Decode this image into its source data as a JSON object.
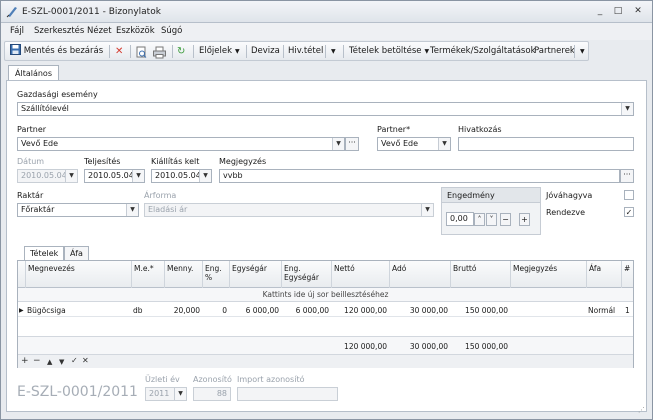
{
  "window": {
    "title": "E-SZL-0001/2011 - Bizonylatok",
    "controls": [
      "_",
      "□",
      "✕"
    ]
  },
  "menu": [
    "Fájl",
    "Szerkesztés",
    "Nézet",
    "Eszközök",
    "Súgó"
  ],
  "toolbar": {
    "save_close": "Mentés és bezárás",
    "elojelek": "Előjelek",
    "deviza": "Deviza",
    "hiv_tetel": "Hiv.tétel",
    "tetelek_betoltese": "Tételek betöltése",
    "termekek": "Termékek/Szolgáltatások",
    "partnerek": "Partnerek"
  },
  "tab": "Általános",
  "form": {
    "gazdasagi_esemeny_label": "Gazdasági esemény",
    "gazdasagi_esemeny_value": "Szállítólevél",
    "partner_label": "Partner",
    "partner_value": "Vevő Ede",
    "partner2_label": "Partner*",
    "partner2_value": "Vevő Ede",
    "hivatkozas_label": "Hivatkozás",
    "hivatkozas_value": "",
    "datum_label": "Dátum",
    "datum_value": "2010.05.04.",
    "teljesites_label": "Teljesítés",
    "teljesites_value": "2010.05.04.",
    "kiallitas_label": "Kiállítás kelt",
    "kiallitas_value": "2010.05.04.",
    "megjegyzes_label": "Megjegyzés",
    "megjegyzes_value": "vvbb",
    "raktar_label": "Raktár",
    "raktar_value": "Főraktár",
    "arforma_label": "Árforma",
    "arforma_value": "Eladási ár",
    "engedmeny_label": "Engedmény",
    "engedmeny_value": "0,00",
    "jovahagyva_label": "Jóváhagyva",
    "rendezve_label": "Rendezve",
    "jovahagyva_checked": false,
    "rendezve_checked": true
  },
  "grid_tabs": [
    "Tételek",
    "Áfa"
  ],
  "grid": {
    "columns": [
      "Megnevezés",
      "M.e.*",
      "Menny.",
      "Eng. %",
      "Egységár",
      "Eng. Egységár",
      "Nettó",
      "Adó",
      "Bruttó",
      "Megjegyzés",
      "Áfa",
      "#"
    ],
    "new_row_hint": "Kattints ide új sor beillesztéséhez",
    "rows": [
      [
        "Bügöcsiga",
        "db",
        "20,000",
        "0",
        "6 000,00",
        "6 000,00",
        "120 000,00",
        "30 000,00",
        "150 000,00",
        "",
        "Normál",
        "1"
      ]
    ],
    "totals": {
      "netto": "120 000,00",
      "ado": "30 000,00",
      "brutto": "150 000,00"
    }
  },
  "footer": {
    "doc_number": "E-SZL-0001/2011",
    "uzleti_ev_label": "Üzleti év",
    "uzleti_ev_value": "2011",
    "azonosito_label": "Azonosító",
    "azonosito_value": "88",
    "import_label": "Import azonosító",
    "import_value": ""
  }
}
